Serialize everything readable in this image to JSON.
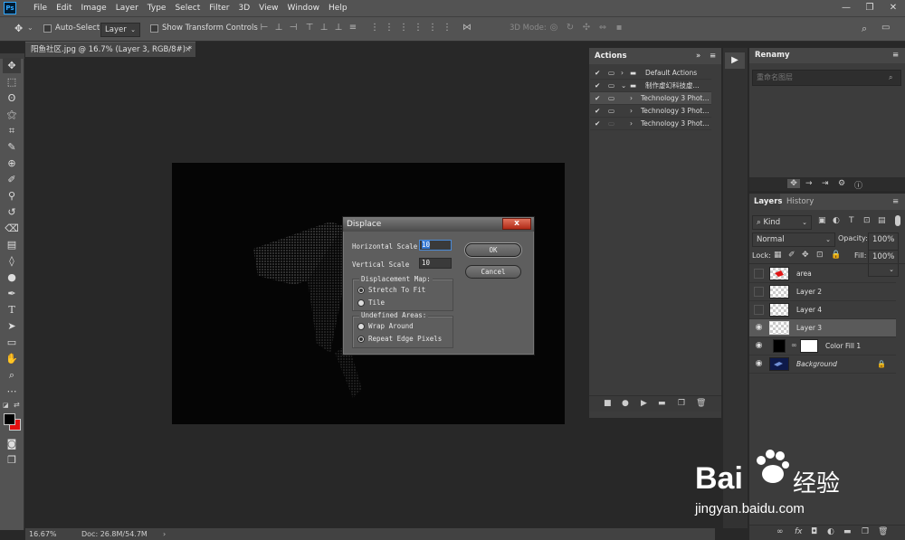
{
  "app": {
    "logo_text": "Ps"
  },
  "menu": [
    "File",
    "Edit",
    "Image",
    "Layer",
    "Type",
    "Select",
    "Filter",
    "3D",
    "View",
    "Window",
    "Help"
  ],
  "options_bar": {
    "auto_select_label": "Auto-Select:",
    "auto_select_value": "Layer",
    "show_transform_label": "Show Transform Controls",
    "mode_3d_label": "3D Mode:"
  },
  "document": {
    "tab_title": "阳鱼社区.jpg @ 16.7% (Layer 3, RGB/8#) *",
    "zoom": "16.67%",
    "doc_size": "Doc: 26.8M/54.7M"
  },
  "dialog": {
    "title": "Displace",
    "horizontal_label": "Horizontal Scale",
    "horizontal_value": "10",
    "vertical_label": "Vertical Scale",
    "vertical_value": "10",
    "map_group": "Displacement Map:",
    "map_options": [
      "Stretch To Fit",
      "Tile"
    ],
    "map_selected": "Stretch To Fit",
    "undef_group": "Undefined Areas:",
    "undef_options": [
      "Wrap Around",
      "Repeat Edge Pixels"
    ],
    "undef_selected": "Repeat Edge Pixels",
    "ok": "OK",
    "cancel": "Cancel",
    "close": "x"
  },
  "actions_panel": {
    "title": "Actions",
    "rows": [
      {
        "label": "Default Actions",
        "checked": true
      },
      {
        "label": "制作虚幻科技虚...",
        "checked": true
      },
      {
        "label": "Technology 3 Phot...",
        "checked": true
      },
      {
        "label": "Technology 3 Phot...",
        "checked": true
      },
      {
        "label": "Technology 3 Phot...",
        "checked": true
      }
    ]
  },
  "renamy_panel": {
    "title": "Renamy",
    "placeholder": "重命名图层"
  },
  "layers_panel": {
    "tabs": [
      "Layers",
      "History"
    ],
    "kind_label": "Kind",
    "blend_mode": "Normal",
    "opacity_label": "Opacity:",
    "opacity_value": "100%",
    "lock_label": "Lock:",
    "fill_label": "Fill:",
    "fill_value": "100%",
    "layers": [
      {
        "name": "area",
        "visible": false
      },
      {
        "name": "Layer 2",
        "visible": false
      },
      {
        "name": "Layer 4",
        "visible": false
      },
      {
        "name": "Layer 3",
        "visible": true,
        "selected": true
      },
      {
        "name": "Color Fill 1",
        "visible": true
      },
      {
        "name": "Background",
        "visible": true,
        "locked": true
      }
    ]
  },
  "watermark": {
    "brand": "Bai",
    "brand_suffix": "经验",
    "url": "jingyan.baidu.com"
  }
}
